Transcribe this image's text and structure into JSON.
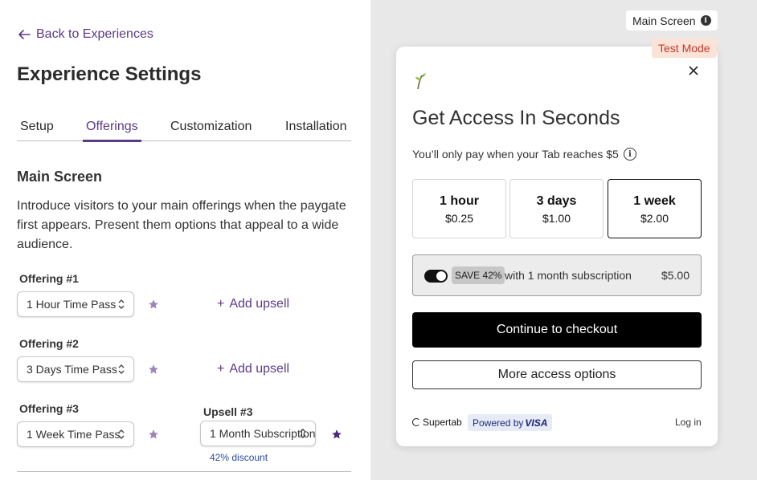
{
  "nav": {
    "back_label": "Back to Experiences"
  },
  "page": {
    "title": "Experience Settings"
  },
  "tabs": [
    {
      "label": "Setup"
    },
    {
      "label": "Offerings"
    },
    {
      "label": "Customization"
    },
    {
      "label": "Installation"
    }
  ],
  "main_screen": {
    "title": "Main Screen",
    "description": "Introduce visitors to your main offerings when the paygate first appears. Present them options that appeal to a wide audience."
  },
  "offerings": [
    {
      "label": "Offering #1",
      "value": "1 Hour Time Pass",
      "add_upsell": "Add upsell"
    },
    {
      "label": "Offering #2",
      "value": "3 Days Time Pass",
      "add_upsell": "Add upsell"
    },
    {
      "label": "Offering #3",
      "value": "1 Week Time Pass"
    }
  ],
  "upsell3": {
    "label": "Upsell #3",
    "value": "1 Month Subscription",
    "discount": "42% discount"
  },
  "preview": {
    "screen_pill": "Main Screen",
    "test_mode": "Test Mode",
    "title": "Get Access In Seconds",
    "pay_note": "You’ll only pay when your Tab reaches $5",
    "options": [
      {
        "duration": "1 hour",
        "price": "$0.25"
      },
      {
        "duration": "3 days",
        "price": "$1.00"
      },
      {
        "duration": "1 week",
        "price": "$2.00"
      }
    ],
    "subscription": {
      "badge": "SAVE 42%",
      "text": "with 1 month subscription",
      "price": "$5.00"
    },
    "checkout_label": "Continue to checkout",
    "more_label": "More access options",
    "brand": "Supertab",
    "powered_by": "Powered by",
    "visa": "VISA",
    "login_label": "Log in"
  },
  "colors": {
    "accent": "#5b3a86",
    "background_right": "#e8e8e8",
    "test_mode": "#c0392b"
  }
}
